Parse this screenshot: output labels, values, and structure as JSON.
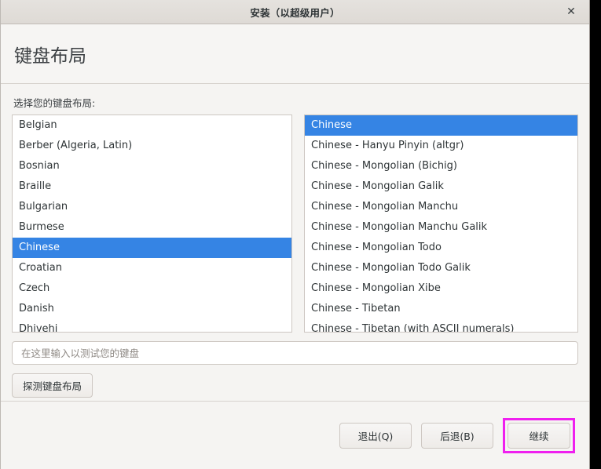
{
  "window": {
    "title": "安装（以超级用户）",
    "close_icon": "close-icon",
    "close_glyph": "✕"
  },
  "page": {
    "heading": "键盘布局",
    "prompt": "选择您的键盘布局:"
  },
  "layout_list": {
    "selected": "Chinese",
    "items": [
      "Belgian",
      "Berber (Algeria, Latin)",
      "Bosnian",
      "Braille",
      "Bulgarian",
      "Burmese",
      "Chinese",
      "Croatian",
      "Czech",
      "Danish",
      "Dhivehi"
    ]
  },
  "variant_list": {
    "selected": "Chinese",
    "items": [
      "Chinese",
      "Chinese - Hanyu Pinyin (altgr)",
      "Chinese - Mongolian (Bichig)",
      "Chinese - Mongolian Galik",
      "Chinese - Mongolian Manchu",
      "Chinese - Mongolian Manchu Galik",
      "Chinese - Mongolian Todo",
      "Chinese - Mongolian Todo Galik",
      "Chinese - Mongolian Xibe",
      "Chinese - Tibetan",
      "Chinese - Tibetan (with ASCII numerals)"
    ]
  },
  "test_field": {
    "value": "",
    "placeholder": "在这里输入以测试您的键盘"
  },
  "buttons": {
    "detect": "探测键盘布局",
    "quit": "退出(Q)",
    "back": "后退(B)",
    "continue": "继续"
  },
  "colors": {
    "selection_blue": "#3584e4",
    "highlight_magenta": "#ef20ef",
    "titlebar": "#e0dcd8",
    "window_bg": "#f5f4f2",
    "list_bg": "#ffffff",
    "border": "#cdc7c2"
  }
}
